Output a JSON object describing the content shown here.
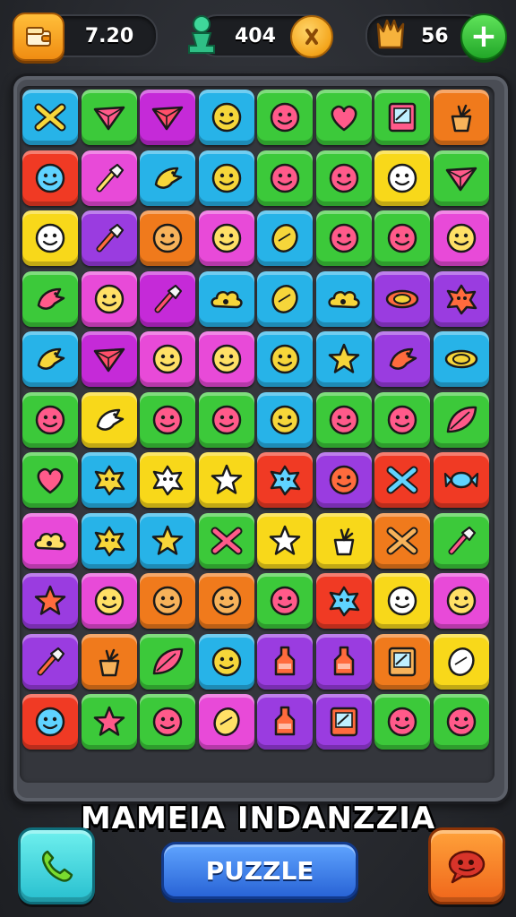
{
  "hud": {
    "wallet": {
      "icon": "wallet-icon",
      "value": "7.20"
    },
    "pieces": {
      "icon": "green-piece-icon",
      "value": "404",
      "coin_icon": "coin-icon"
    },
    "crowns": {
      "icon": "crown-icon",
      "value": "56",
      "plus_icon": "plus-icon"
    }
  },
  "board": {
    "rows": 12,
    "cols": 8,
    "tiles": [
      [
        {
          "c": "#27b3e8",
          "i": "cross"
        },
        {
          "c": "#3cc93a",
          "i": "triangle"
        },
        {
          "c": "#c52ad8",
          "i": "triangle"
        },
        {
          "c": "#27b3e8",
          "i": "face"
        },
        {
          "c": "#3cc93a",
          "i": "face"
        },
        {
          "c": "#3cc93a",
          "i": "heart"
        },
        {
          "c": "#3cc93a",
          "i": "frame"
        },
        {
          "c": "#f07a1c",
          "i": "plant"
        }
      ],
      [
        {
          "c": "#f03a24",
          "i": "face"
        },
        {
          "c": "#e84ad8",
          "i": "brush"
        },
        {
          "c": "#27b3e8",
          "i": "bird"
        },
        {
          "c": "#27b3e8",
          "i": "face"
        },
        {
          "c": "#3cc93a",
          "i": "face"
        },
        {
          "c": "#3cc93a",
          "i": "face"
        },
        {
          "c": "#f8d81a",
          "i": "face"
        },
        {
          "c": "#3cc93a",
          "i": "triangle"
        }
      ],
      [
        {
          "c": "#f8d81a",
          "i": "face"
        },
        {
          "c": "#9a3ce0",
          "i": "brush"
        },
        {
          "c": "#f07a1c",
          "i": "face"
        },
        {
          "c": "#e84ad8",
          "i": "face"
        },
        {
          "c": "#27b3e8",
          "i": "oval"
        },
        {
          "c": "#3cc93a",
          "i": "face"
        },
        {
          "c": "#3cc93a",
          "i": "face"
        },
        {
          "c": "#e84ad8",
          "i": "face"
        }
      ],
      [
        {
          "c": "#3cc93a",
          "i": "bird"
        },
        {
          "c": "#e84ad8",
          "i": "face"
        },
        {
          "c": "#c52ad8",
          "i": "brush"
        },
        {
          "c": "#27b3e8",
          "i": "cloud"
        },
        {
          "c": "#27b3e8",
          "i": "oval"
        },
        {
          "c": "#27b3e8",
          "i": "cloud"
        },
        {
          "c": "#9a3ce0",
          "i": "eye"
        },
        {
          "c": "#9a3ce0",
          "i": "splat"
        }
      ],
      [
        {
          "c": "#27b3e8",
          "i": "bird"
        },
        {
          "c": "#c52ad8",
          "i": "triangle"
        },
        {
          "c": "#e84ad8",
          "i": "face"
        },
        {
          "c": "#e84ad8",
          "i": "face"
        },
        {
          "c": "#27b3e8",
          "i": "face"
        },
        {
          "c": "#27b3e8",
          "i": "star"
        },
        {
          "c": "#9a3ce0",
          "i": "bird"
        },
        {
          "c": "#27b3e8",
          "i": "eye"
        }
      ],
      [
        {
          "c": "#3cc93a",
          "i": "face"
        },
        {
          "c": "#f8d81a",
          "i": "bird"
        },
        {
          "c": "#3cc93a",
          "i": "face"
        },
        {
          "c": "#3cc93a",
          "i": "face"
        },
        {
          "c": "#27b3e8",
          "i": "face"
        },
        {
          "c": "#3cc93a",
          "i": "face"
        },
        {
          "c": "#3cc93a",
          "i": "face"
        },
        {
          "c": "#3cc93a",
          "i": "leaf"
        }
      ],
      [
        {
          "c": "#3cc93a",
          "i": "heart"
        },
        {
          "c": "#27b3e8",
          "i": "splat"
        },
        {
          "c": "#f8d81a",
          "i": "splat"
        },
        {
          "c": "#f8d81a",
          "i": "star"
        },
        {
          "c": "#f03a24",
          "i": "splat"
        },
        {
          "c": "#9a3ce0",
          "i": "face"
        },
        {
          "c": "#f03a24",
          "i": "cross"
        },
        {
          "c": "#f03a24",
          "i": "candy"
        }
      ],
      [
        {
          "c": "#e84ad8",
          "i": "cloud"
        },
        {
          "c": "#27b3e8",
          "i": "splat"
        },
        {
          "c": "#27b3e8",
          "i": "star"
        },
        {
          "c": "#3cc93a",
          "i": "cross"
        },
        {
          "c": "#f8d81a",
          "i": "star"
        },
        {
          "c": "#f8d81a",
          "i": "plant"
        },
        {
          "c": "#f07a1c",
          "i": "cross"
        },
        {
          "c": "#3cc93a",
          "i": "brush"
        }
      ],
      [
        {
          "c": "#9a3ce0",
          "i": "star"
        },
        {
          "c": "#e84ad8",
          "i": "face"
        },
        {
          "c": "#f07a1c",
          "i": "face"
        },
        {
          "c": "#f07a1c",
          "i": "face"
        },
        {
          "c": "#3cc93a",
          "i": "face"
        },
        {
          "c": "#f03a24",
          "i": "splat"
        },
        {
          "c": "#f8d81a",
          "i": "face"
        },
        {
          "c": "#e84ad8",
          "i": "face"
        }
      ],
      [
        {
          "c": "#9a3ce0",
          "i": "brush"
        },
        {
          "c": "#f07a1c",
          "i": "plant"
        },
        {
          "c": "#3cc93a",
          "i": "leaf"
        },
        {
          "c": "#27b3e8",
          "i": "face"
        },
        {
          "c": "#9a3ce0",
          "i": "bottle"
        },
        {
          "c": "#9a3ce0",
          "i": "bottle"
        },
        {
          "c": "#f07a1c",
          "i": "frame"
        },
        {
          "c": "#f8d81a",
          "i": "oval"
        }
      ],
      [
        {
          "c": "#f03a24",
          "i": "face"
        },
        {
          "c": "#3cc93a",
          "i": "star"
        },
        {
          "c": "#3cc93a",
          "i": "face"
        },
        {
          "c": "#e84ad8",
          "i": "oval"
        },
        {
          "c": "#9a3ce0",
          "i": "bottle"
        },
        {
          "c": "#9a3ce0",
          "i": "frame"
        },
        {
          "c": "#3cc93a",
          "i": "face"
        },
        {
          "c": "#3cc93a",
          "i": "face"
        }
      ]
    ]
  },
  "footer": {
    "title": "MAMEIA INDANZZIA",
    "play_label": "PUZZLE",
    "left_icon": "phone-icon",
    "right_icon": "chat-icon"
  }
}
